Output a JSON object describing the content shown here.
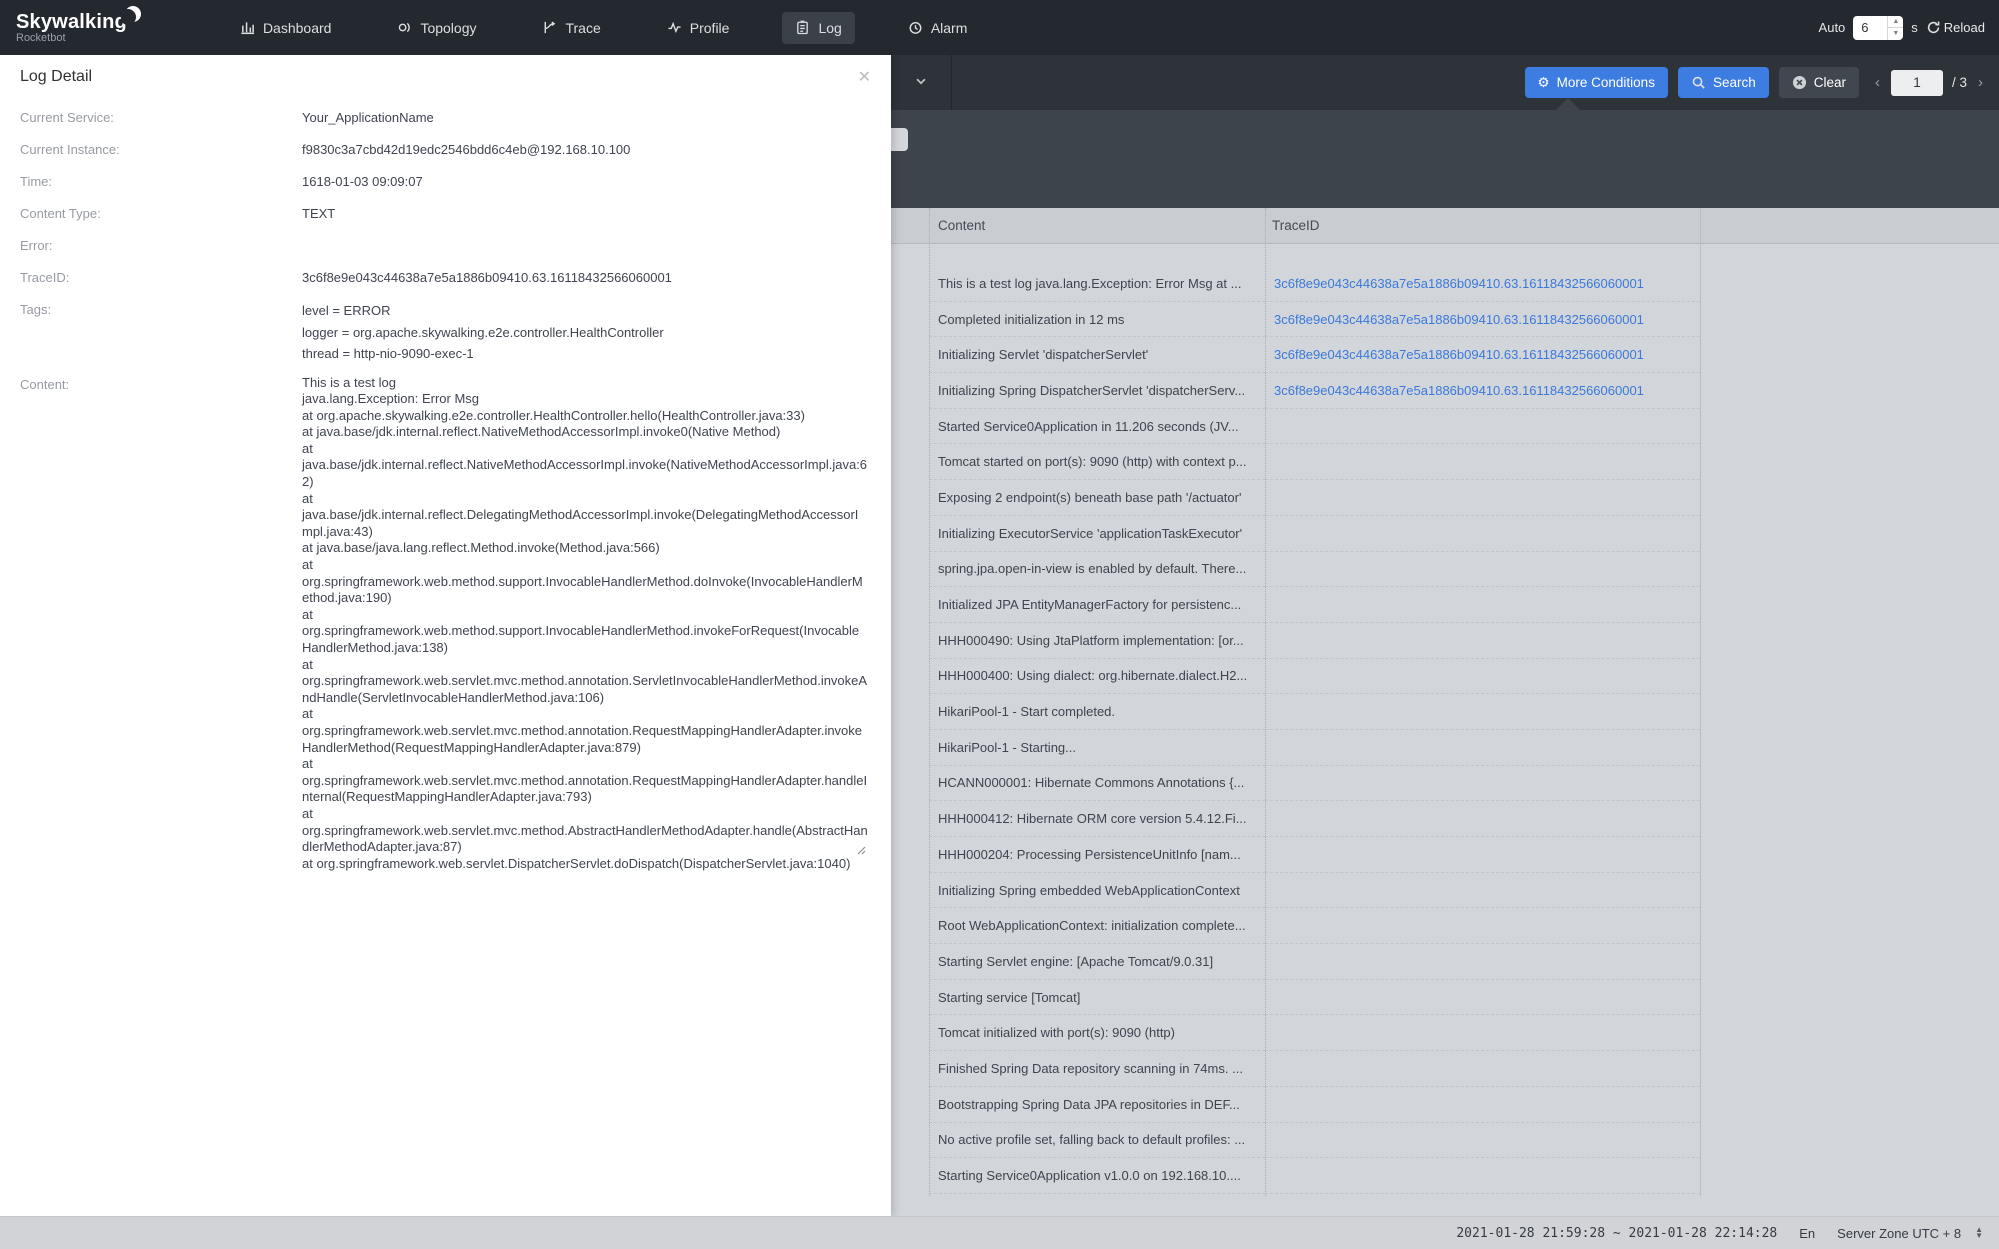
{
  "nav": {
    "logo": {
      "title": "Skywalking",
      "subtitle": "Rocketbot"
    },
    "items": [
      {
        "label": "Dashboard",
        "icon": "dashboard-icon",
        "active": false
      },
      {
        "label": "Topology",
        "icon": "topology-icon",
        "active": false
      },
      {
        "label": "Trace",
        "icon": "trace-icon",
        "active": false
      },
      {
        "label": "Profile",
        "icon": "profile-icon",
        "active": false
      },
      {
        "label": "Log",
        "icon": "log-icon",
        "active": true
      },
      {
        "label": "Alarm",
        "icon": "alarm-icon",
        "active": false
      }
    ],
    "auto": {
      "label": "Auto",
      "value": "6",
      "unit": "s",
      "reload_label": "Reload"
    }
  },
  "toolbar": {
    "more_conditions_label": "More Conditions",
    "search_label": "Search",
    "clear_label": "Clear",
    "pagination": {
      "current": "1",
      "total_label": "/ 3"
    }
  },
  "log_detail": {
    "title": "Log Detail",
    "fields": [
      {
        "label": "Current Service:",
        "value": "Your_ApplicationName"
      },
      {
        "label": "Current Instance:",
        "value": "f9830c3a7cbd42d19edc2546bdd6c4eb@192.168.10.100"
      },
      {
        "label": "Time:",
        "value": "1618-01-03 09:09:07"
      },
      {
        "label": "Content Type:",
        "value": "TEXT"
      },
      {
        "label": "Error:",
        "value": ""
      },
      {
        "label": "TraceID:",
        "value": "3c6f8e9e043c44638a7e5a1886b09410.63.16118432566060001"
      }
    ],
    "tags_label": "Tags:",
    "tags": [
      "level = ERROR",
      "logger = org.apache.skywalking.e2e.controller.HealthController",
      "thread = http-nio-9090-exec-1"
    ],
    "content_label": "Content:",
    "content": "This is a test log\njava.lang.Exception: Error Msg\nat org.apache.skywalking.e2e.controller.HealthController.hello(HealthController.java:33)\nat java.base/jdk.internal.reflect.NativeMethodAccessorImpl.invoke0(Native Method)\nat java.base/jdk.internal.reflect.NativeMethodAccessorImpl.invoke(NativeMethodAccessorImpl.java:62)\nat java.base/jdk.internal.reflect.DelegatingMethodAccessorImpl.invoke(DelegatingMethodAccessorImpl.java:43)\nat java.base/java.lang.reflect.Method.invoke(Method.java:566)\nat org.springframework.web.method.support.InvocableHandlerMethod.doInvoke(InvocableHandlerMethod.java:190)\nat org.springframework.web.method.support.InvocableHandlerMethod.invokeForRequest(InvocableHandlerMethod.java:138)\nat org.springframework.web.servlet.mvc.method.annotation.ServletInvocableHandlerMethod.invokeAndHandle(ServletInvocableHandlerMethod.java:106)\nat org.springframework.web.servlet.mvc.method.annotation.RequestMappingHandlerAdapter.invokeHandlerMethod(RequestMappingHandlerAdapter.java:879)\nat org.springframework.web.servlet.mvc.method.annotation.RequestMappingHandlerAdapter.handleInternal(RequestMappingHandlerAdapter.java:793)\nat org.springframework.web.servlet.mvc.method.AbstractHandlerMethodAdapter.handle(AbstractHandlerMethodAdapter.java:87)\nat org.springframework.web.servlet.DispatcherServlet.doDispatch(DispatcherServlet.java:1040)"
  },
  "table": {
    "columns": [
      "Content",
      "TraceID"
    ],
    "rows": [
      {
        "content": "This is a test log java.lang.Exception: Error Msg at ...",
        "trace_id": "3c6f8e9e043c44638a7e5a1886b09410.63.16118432566060001"
      },
      {
        "content": "Completed initialization in 12 ms",
        "trace_id": "3c6f8e9e043c44638a7e5a1886b09410.63.16118432566060001"
      },
      {
        "content": "Initializing Servlet 'dispatcherServlet'",
        "trace_id": "3c6f8e9e043c44638a7e5a1886b09410.63.16118432566060001"
      },
      {
        "content": "Initializing Spring DispatcherServlet 'dispatcherServ...",
        "trace_id": "3c6f8e9e043c44638a7e5a1886b09410.63.16118432566060001"
      },
      {
        "content": "Started Service0Application in 11.206 seconds (JV...",
        "trace_id": ""
      },
      {
        "content": "Tomcat started on port(s): 9090 (http) with context p...",
        "trace_id": ""
      },
      {
        "content": "Exposing 2 endpoint(s) beneath base path '/actuator'",
        "trace_id": ""
      },
      {
        "content": "Initializing ExecutorService 'applicationTaskExecutor'",
        "trace_id": ""
      },
      {
        "content": "spring.jpa.open-in-view is enabled by default. There...",
        "trace_id": ""
      },
      {
        "content": "Initialized JPA EntityManagerFactory for persistenc...",
        "trace_id": ""
      },
      {
        "content": "HHH000490: Using JtaPlatform implementation: [or...",
        "trace_id": ""
      },
      {
        "content": "HHH000400: Using dialect: org.hibernate.dialect.H2...",
        "trace_id": ""
      },
      {
        "content": "HikariPool-1 - Start completed.",
        "trace_id": ""
      },
      {
        "content": "HikariPool-1 - Starting...",
        "trace_id": ""
      },
      {
        "content": "HCANN000001: Hibernate Commons Annotations {...",
        "trace_id": ""
      },
      {
        "content": "HHH000412: Hibernate ORM core version 5.4.12.Fi...",
        "trace_id": ""
      },
      {
        "content": "HHH000204: Processing PersistenceUnitInfo [nam...",
        "trace_id": ""
      },
      {
        "content": "Initializing Spring embedded WebApplicationContext",
        "trace_id": ""
      },
      {
        "content": "Root WebApplicationContext: initialization complete...",
        "trace_id": ""
      },
      {
        "content": "Starting Servlet engine: [Apache Tomcat/9.0.31]",
        "trace_id": ""
      },
      {
        "content": "Starting service [Tomcat]",
        "trace_id": ""
      },
      {
        "content": "Tomcat initialized with port(s): 9090 (http)",
        "trace_id": ""
      },
      {
        "content": "Finished Spring Data repository scanning in 74ms. ...",
        "trace_id": ""
      },
      {
        "content": "Bootstrapping Spring Data JPA repositories in DEF...",
        "trace_id": ""
      },
      {
        "content": "No active profile set, falling back to default profiles: ...",
        "trace_id": ""
      },
      {
        "content": "Starting Service0Application v1.0.0 on 192.168.10....",
        "trace_id": ""
      }
    ]
  },
  "footer": {
    "time_range": "2021-01-28 21:59:28 ~ 2021-01-28 22:14:28",
    "lang": "En",
    "zone": "Server Zone UTC + 8"
  },
  "colors": {
    "navbar": "#242930",
    "toolbar": "#2d3339",
    "panel": "#3e444b",
    "primary_blue": "#3d7ce0",
    "trace_link": "#3a79dd",
    "table_header": "#c9ccd1",
    "table_body": "#d2d5d9",
    "footer_bar": "#d1d3d7"
  }
}
